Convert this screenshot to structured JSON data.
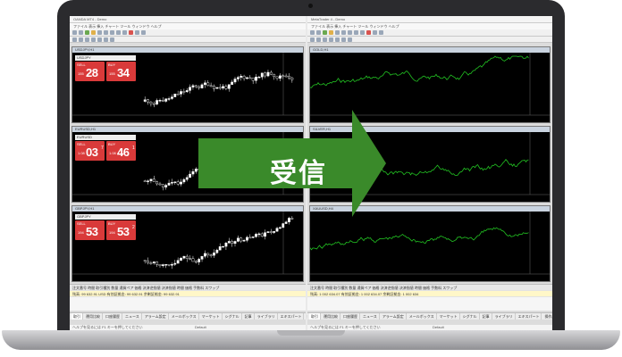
{
  "overlay": {
    "label": "受信",
    "color": "#3a8a2a"
  },
  "left_terminal": {
    "title": "OANDA MT4 - Demo",
    "menu": "ファイル 表示 挿入 チャート ツール ウィンドウ ヘルプ",
    "charts": [
      {
        "title": "USDJPY,H1",
        "symbol": "USDJPY",
        "sell_label": "SELL",
        "buy_label": "BUY",
        "sell_pre": "155",
        "sell_big": "28",
        "sell_sup": "",
        "buy_pre": "155",
        "buy_big": "34",
        "buy_sup": ""
      },
      {
        "title": "EURUSD,H1",
        "symbol": "EURUSD",
        "sell_label": "SELL",
        "buy_label": "BUY",
        "sell_pre": "1.08",
        "sell_big": "03",
        "sell_sup": "7",
        "buy_pre": "1.08",
        "buy_big": "46",
        "buy_sup": "1"
      },
      {
        "title": "GBPJPY,H1",
        "symbol": "GBPJPY",
        "sell_label": "SELL",
        "buy_label": "BUY",
        "sell_pre": "194",
        "sell_big": "53",
        "sell_sup": "",
        "buy_pre": "194",
        "buy_big": "53",
        "buy_sup": "2"
      }
    ],
    "orders_header": "注文番号  時間  取引種別  数量  通貨ペア  価格  決済逆指値  決済指値  時間  価格  手数料  スワップ",
    "account_row": "残高: 99 632.91 USD  有効証拠金: 99 632.91  余剰証拠金: 99 632.91",
    "tabs": [
      "取引",
      "運用比較",
      "口座履歴",
      "ニュース",
      "アラーム設定",
      "メールボックス",
      "マーケット",
      "シグナル",
      "記事",
      "ライブラリ",
      "エキスパート",
      "操作履歴"
    ],
    "active_tab": 0,
    "footer": "ヘルプを見るには F1 キーを押してください",
    "footer_right": "Default"
  },
  "right_terminal": {
    "title": "MetaTrader 4 - Demo",
    "menu": "ファイル 表示 挿入 チャート ツール ウィンドウ ヘルプ",
    "charts": [
      {
        "title": "GOLD,H1"
      },
      {
        "title": "SILVER,H1"
      },
      {
        "title": "XAUUSD,H4"
      }
    ],
    "orders_header": "注文番号  時間  取引種別  数量  通貨ペア  価格  決済逆指値  決済指値  時間  価格  手数料  スワップ",
    "account_row": "残高: 1 002 634.07  有効証拠金: 1 002 634.07  余剰証拠金: 1 002 634",
    "tabs": [
      "取引",
      "運用比較",
      "口座履歴",
      "ニュース",
      "アラーム設定",
      "メールボックス",
      "マーケット",
      "シグナル",
      "記事",
      "ライブラリ",
      "エキスパート",
      "操作履歴"
    ],
    "active_tab": 0,
    "footer": "ヘルプを見るには F1 キーを押してください",
    "footer_right": "Default"
  }
}
